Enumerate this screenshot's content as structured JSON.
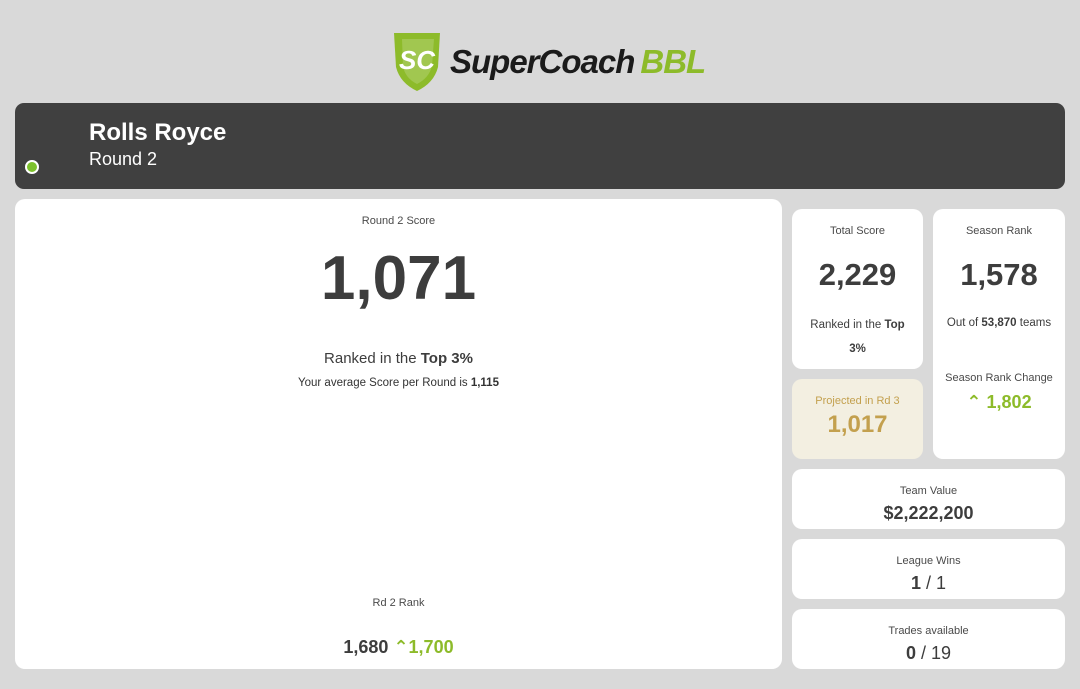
{
  "logo": {
    "badge_text": "SC",
    "name": "SuperCoach",
    "suffix": "BBL"
  },
  "header": {
    "team_name": "Rolls Royce",
    "round": "Round 2",
    "status_color": "#7cc12c"
  },
  "round_score": {
    "label": "Round 2 Score",
    "score": "1,071",
    "ranked_prefix": "Ranked in the ",
    "ranked_value": "Top 3%",
    "average_prefix": "Your average Score per Round is ",
    "average_value": "1,115",
    "rd_rank_label": "Rd 2 Rank",
    "rd_rank": "1,680",
    "rd_rank_change": "1,700"
  },
  "total_score": {
    "label": "Total Score",
    "value": "2,229",
    "ranked_prefix": "Ranked in the ",
    "ranked_value": "Top 3%"
  },
  "projected": {
    "label": "Projected in Rd 3",
    "value": "1,017"
  },
  "season_rank": {
    "label": "Season Rank",
    "value": "1,578",
    "out_of_prefix": "Out of ",
    "out_of_value": "53,870",
    "out_of_suffix": " teams",
    "change_label": "Season Rank Change",
    "change_value": "1,802"
  },
  "team_value": {
    "label": "Team Value",
    "value": "$2,222,200"
  },
  "league_wins": {
    "label": "League Wins",
    "wins": "1",
    "separator": " / ",
    "total": "1"
  },
  "trades": {
    "label": "Trades available",
    "used": "0",
    "separator": " / ",
    "total": "19"
  },
  "icons": {
    "up_arrow": "chevron-up-icon"
  },
  "colors": {
    "accent_green": "#8dbb2a",
    "gold": "#c3a04e",
    "header_bg": "#404040"
  }
}
